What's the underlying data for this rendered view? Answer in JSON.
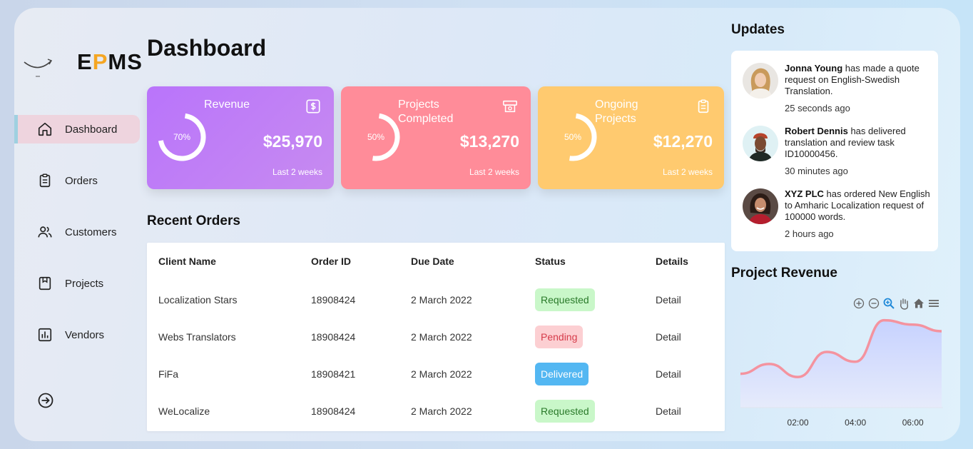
{
  "app": {
    "logo": {
      "prefix": "E",
      "accent": "P",
      "suffix": "MS"
    },
    "page_title": "Dashboard"
  },
  "sidebar": {
    "items": [
      {
        "label": "Dashboard",
        "icon": "home-icon"
      },
      {
        "label": "Orders",
        "icon": "clipboard-icon"
      },
      {
        "label": "Customers",
        "icon": "users-icon"
      },
      {
        "label": "Projects",
        "icon": "bookmark-icon"
      },
      {
        "label": "Vendors",
        "icon": "bar-chart-icon"
      }
    ],
    "logout_icon": "logout-icon"
  },
  "cards": [
    {
      "title": "Revenue",
      "percent": "70%",
      "percent_value": 0.7,
      "value": "$25,970",
      "sub": "Last 2 weeks",
      "icon": "dollar-icon"
    },
    {
      "title": "Projects Completed",
      "percent": "50%",
      "percent_value": 0.5,
      "value": "$13,270",
      "sub": "Last 2 weeks",
      "icon": "money-icon"
    },
    {
      "title": "Ongoing Projects",
      "percent": "50%",
      "percent_value": 0.5,
      "value": "$12,270",
      "sub": "Last 2 weeks",
      "icon": "clipboard-icon"
    }
  ],
  "recent_orders": {
    "title": "Recent Orders",
    "columns": [
      "Client Name",
      "Order ID",
      "Due Date",
      "Status",
      "Details"
    ],
    "rows": [
      {
        "client": "Localization Stars",
        "order_id": "18908424",
        "due": "2 March 2022",
        "status": "Requested",
        "detail": "Detail"
      },
      {
        "client": "Webs Translators",
        "order_id": "18908424",
        "due": "2 March 2022",
        "status": "Pending",
        "detail": "Detail"
      },
      {
        "client": "FiFa",
        "order_id": "18908421",
        "due": "2 March 2022",
        "status": "Delivered",
        "detail": "Detail"
      },
      {
        "client": "WeLocalize",
        "order_id": "18908424",
        "due": "2 March 2022",
        "status": "Requested",
        "detail": "Detail"
      }
    ]
  },
  "updates": {
    "title": "Updates",
    "items": [
      {
        "name": "Jonna Young",
        "text": " has made a quote request on English-Swedish Translation.",
        "time": "25 seconds ago"
      },
      {
        "name": "Robert Dennis",
        "text": " has delivered translation and review task ID10000456.",
        "time": "30 minutes ago"
      },
      {
        "name": "XYZ PLC",
        "text": " has ordered New English to Amharic Localization request of 100000 words.",
        "time": "2 hours ago"
      }
    ]
  },
  "project_revenue": {
    "title": "Project Revenue",
    "tools": [
      "zoom-in-icon",
      "zoom-out-icon",
      "zoom-select-icon",
      "pan-icon",
      "home-icon",
      "menu-icon"
    ]
  },
  "chart_data": {
    "type": "area",
    "x": [
      "00:00",
      "01:00",
      "02:00",
      "03:00",
      "04:00",
      "05:00",
      "06:00",
      "06:30"
    ],
    "x_ticks": [
      "02:00",
      "04:00",
      "06:00"
    ],
    "values": [
      31,
      40,
      28,
      51,
      42,
      80,
      76,
      70
    ],
    "title": "",
    "colors": {
      "line": "#f4939f",
      "fill_top": "#c7d2ff",
      "fill_bottom": "#e6ebfb"
    }
  },
  "colors": {
    "revenue_card": "#b974fb",
    "completed_card": "#ff8c99",
    "ongoing_card": "#ffca6f",
    "accent": "#f5a623",
    "link": "#2ba8e0"
  }
}
